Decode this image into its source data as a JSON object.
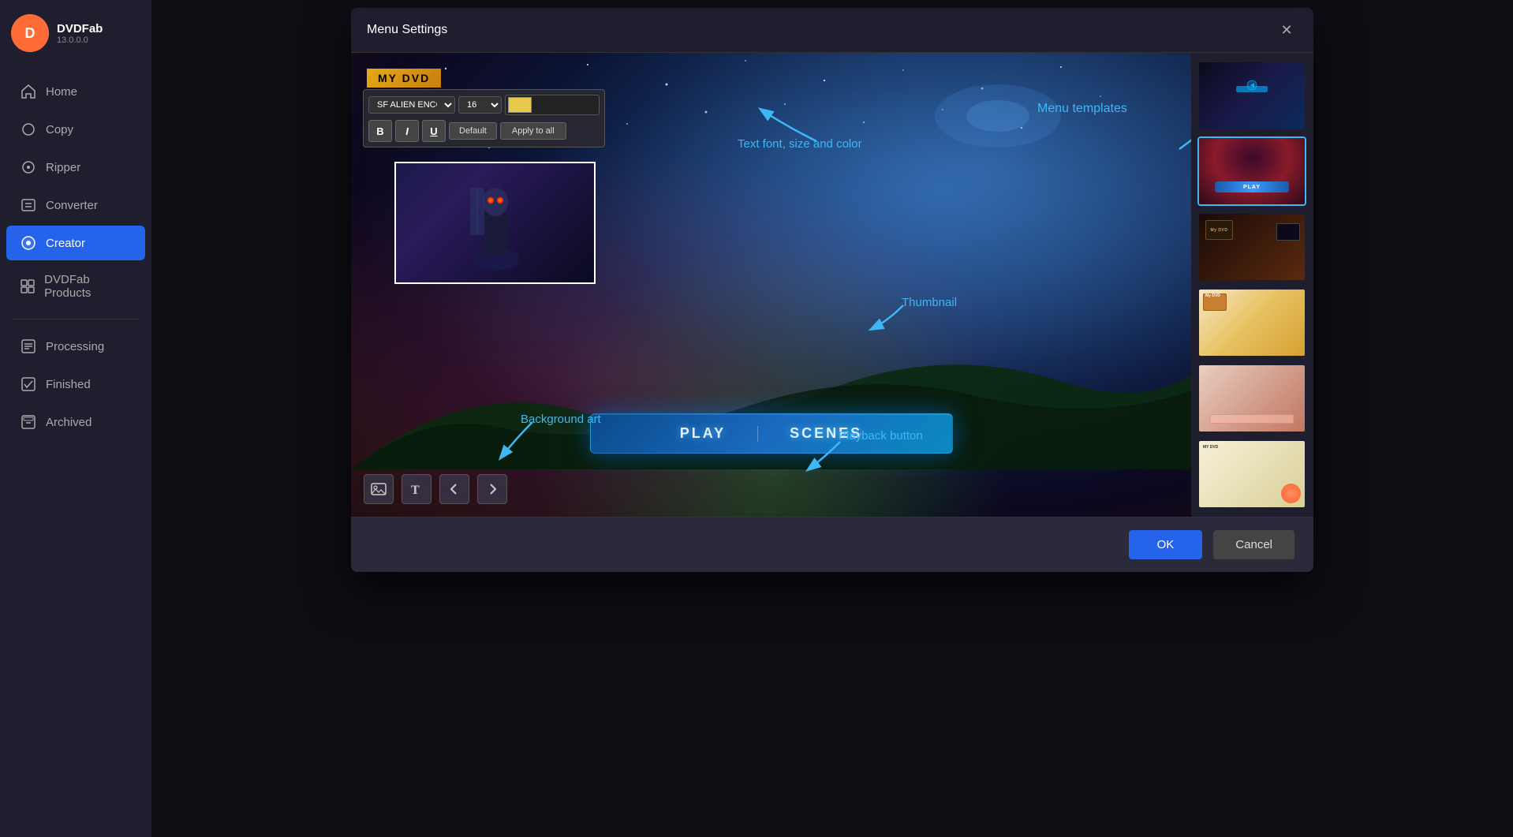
{
  "app": {
    "brand": "DVDFab",
    "version": "13.0.0.0"
  },
  "sidebar": {
    "items": [
      {
        "id": "home",
        "label": "Home",
        "icon": "🏠",
        "active": false
      },
      {
        "id": "copy",
        "label": "Copy",
        "icon": "📋",
        "active": false
      },
      {
        "id": "ripper",
        "label": "Ripper",
        "icon": "💿",
        "active": false
      },
      {
        "id": "converter",
        "label": "Converter",
        "icon": "🔄",
        "active": false
      },
      {
        "id": "creator",
        "label": "Creator",
        "icon": "🎬",
        "active": true
      },
      {
        "id": "dvdfab-products",
        "label": "DVDFab Products",
        "icon": "📦",
        "active": false
      }
    ],
    "bottom_items": [
      {
        "id": "processing",
        "label": "Processing",
        "icon": "⚙️"
      },
      {
        "id": "finished",
        "label": "Finished",
        "icon": "✅"
      },
      {
        "id": "archived",
        "label": "Archived",
        "icon": "🗃️"
      }
    ]
  },
  "modal": {
    "title": "Menu Settings",
    "close_label": "✕"
  },
  "toolbar": {
    "font_name": "SF ALIEN ENCOU",
    "font_size": "16",
    "bold_label": "B",
    "italic_label": "I",
    "underline_label": "U",
    "default_label": "Default",
    "apply_all_label": "Apply to all"
  },
  "dvd_title": "MY DVD",
  "playback": {
    "play_label": "PLAY",
    "scenes_label": "SCENES"
  },
  "annotations": {
    "text_font": "Text font, size and color",
    "menu_templates": "Menu templates",
    "thumbnail": "Thumbnail",
    "background_art": "Background art",
    "playback_button": "Playback button"
  },
  "footer": {
    "ok_label": "OK",
    "cancel_label": "Cancel"
  },
  "templates": [
    {
      "id": 1,
      "selected": false,
      "style": "tmpl-1"
    },
    {
      "id": 2,
      "selected": true,
      "style": "tmpl-2"
    },
    {
      "id": 3,
      "selected": false,
      "style": "tmpl-3"
    },
    {
      "id": 4,
      "selected": false,
      "style": "tmpl-4"
    },
    {
      "id": 5,
      "selected": false,
      "style": "tmpl-5"
    },
    {
      "id": 6,
      "selected": false,
      "style": "tmpl-6"
    }
  ]
}
